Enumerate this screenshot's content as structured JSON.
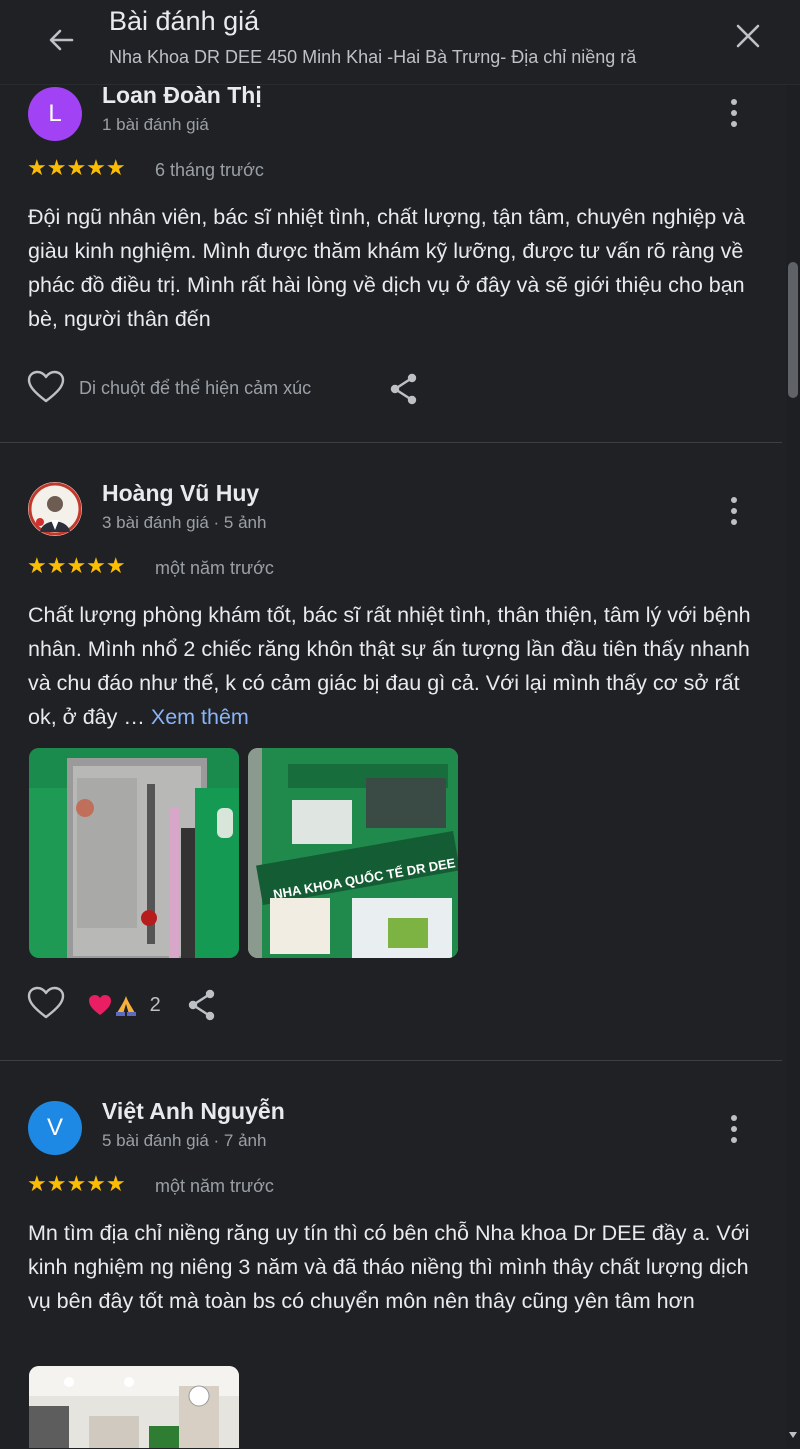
{
  "header": {
    "title": "Bài đánh giá",
    "subtitle": "Nha Khoa DR DEE 450 Minh Khai -Hai Bà Trưng- Địa chỉ niềng ră"
  },
  "reviews": [
    {
      "avatar_letter": "L",
      "avatar_color": "#a142f4",
      "name": "Loan Đoàn Thị",
      "meta": "1 bài đánh giá",
      "stars": "★★★★★",
      "date": "6 tháng trước",
      "text": "Đội ngũ nhân viên, bác sĩ nhiệt tình, chất lượng, tận tâm, chuyên nghiệp và giàu kinh nghiệm. Mình được thăm khám kỹ lưỡng, được tư vấn rõ ràng về phác đồ điều trị. Mình rất hài lòng về dịch vụ ở đây và sẽ giới thiệu cho bạn bè, người thân đến",
      "hover_text": "Di chuột để thể hiện cảm xúc"
    },
    {
      "name": "Hoàng Vũ Huy",
      "meta": "3 bài đánh giá · 5 ảnh",
      "stars": "★★★★★",
      "date": "một năm trước",
      "text": "Chất lượng phòng khám tốt, bác sĩ rất nhiệt tình, thân thiện, tâm lý với bệnh nhân. Mình nhổ 2 chiếc răng khôn thật sự ấn tượng lần đầu tiên thấy nhanh và chu đáo như thế, k có cảm giác bị đau gì cả. Với lại mình thấy cơ sở rất ok, ở đây …",
      "more_link": "Xem thêm",
      "photo_sign_lines": [
        "NHA KHOA QUỐC TẾ DR DEE"
      ],
      "reaction_count": "2"
    },
    {
      "avatar_letter": "V",
      "avatar_color": "#1e88e5",
      "name": "Việt Anh Nguyễn",
      "meta": "5 bài đánh giá · 7 ảnh",
      "stars": "★★★★★",
      "date": "một năm trước",
      "text": "Mn tìm địa chỉ niềng răng uy tín thì có bên chỗ Nha khoa Dr DEE đầy a. Với kinh nghiệm ng niêng 3 năm và đã tháo niềng thì mình thây chất lượng dịch vụ bên đây tốt mà toàn bs có chuyển môn nên thây cũng yên tâm hơn"
    }
  ],
  "colors": {
    "background": "#202124",
    "star": "#fbbc04",
    "link": "#8ab4f8",
    "clinic_green": "#1f8a4c"
  }
}
